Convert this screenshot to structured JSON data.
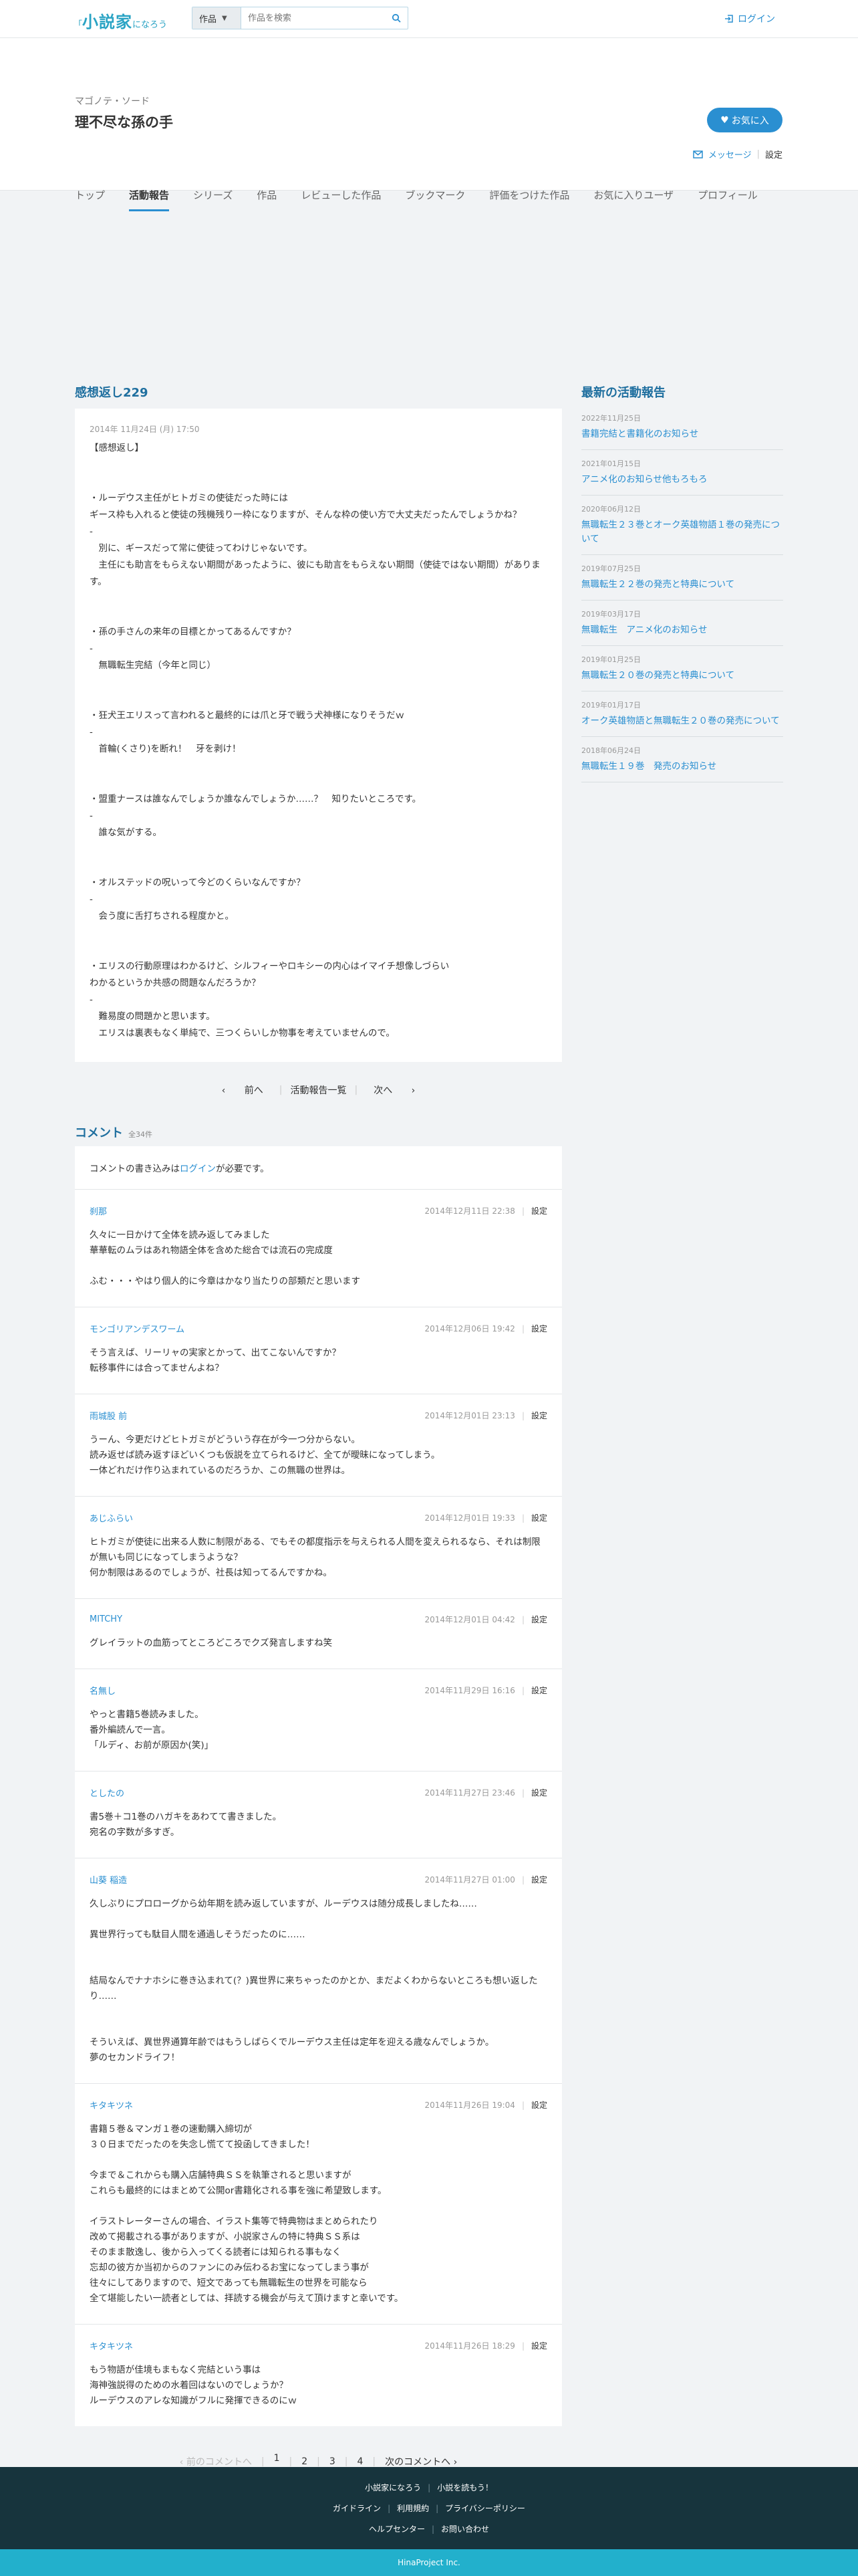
{
  "header": {
    "logo_small_left": "「",
    "logo_main": "小説家",
    "logo_small_right": "になろう",
    "search_select": "作品",
    "search_placeholder": "作品を検索",
    "login": "ログイン"
  },
  "user": {
    "sub": "マゴノテ・ソード",
    "name": "理不尽な孫の手",
    "favorite_button": "お気に入",
    "message": "メッセージ",
    "settings": "設定"
  },
  "tabs": [
    {
      "label": "トップ"
    },
    {
      "label": "活動報告"
    },
    {
      "label": "シリーズ"
    },
    {
      "label": "作品"
    },
    {
      "label": "レビューした作品"
    },
    {
      "label": "ブックマーク"
    },
    {
      "label": "評価をつけた作品"
    },
    {
      "label": "お気に入りユーザ"
    },
    {
      "label": "プロフィール"
    }
  ],
  "post": {
    "title": "感想返し229",
    "date": "2014年 11月24日 (月) 17:50",
    "body": "【感想返し】\n\n\n・ルーデウス主任がヒトガミの使徒だった時には\nギース枠も入れると使徒の残機残り一枠になりますが、そんな枠の使い方で大丈夫だったんでしょうかね？\n-\n　別に、ギースだって常に使徒ってわけじゃないです。\n　主任にも助言をもらえない期間があったように、彼にも助言をもらえない期間（使徒ではない期間）があります。\n\n\n・孫の手さんの来年の目標とかってあるんですか？\n-\n　無職転生完結（今年と同じ）\n\n\n・狂犬王エリスって言われると最終的には爪と牙で戦う犬神様になりそうだｗ\n-\n　首輪(くさり)を断れ！　牙を剥け！\n\n\n・盟重ナースは誰なんでしょうか誰なんでしょうか……？　知りたいところです。\n-\n　誰な気がする。\n\n\n・オルステッドの呪いって今どのくらいなんですか？\n-\n　会う度に舌打ちされる程度かと。\n\n\n・エリスの行動原理はわかるけど、シルフィーやロキシーの内心はイマイチ想像しづらい\nわかるというか共感の問題なんだろうか？\n-\n　難易度の問題かと思います。\n　エリスは裏表もなく単純で、三つくらいしか物事を考えていませんので。",
    "pager_prev": "前へ",
    "pager_list": "活動報告一覧",
    "pager_next": "次へ"
  },
  "comments": {
    "title": "コメント",
    "count": "全34件",
    "login_note_before": "コメントの書き込みは",
    "login_note_link": "ログイン",
    "login_note_after": "が必要です。",
    "settings": "設定",
    "items": [
      {
        "name": "刹那",
        "date": "2014年12月11日 22:38",
        "text": "久々に一日かけて全体を読み返してみました\n華華転のムラはあれ物語全体を含めた総合では流石の完成度\n\nふむ・・・やはり個人的に今章はかなり当たりの部類だと思います"
      },
      {
        "name": "モンゴリアンデスワーム",
        "date": "2014年12月06日 19:42",
        "text": "そう言えば、リーリャの実家とかって、出てこないんですか？\n転移事件には合ってませんよね？"
      },
      {
        "name": "雨城股 前",
        "date": "2014年12月01日 23:13",
        "text": "うーん、今更だけどヒトガミがどういう存在が今一つ分からない。\n読み返せば読み返すほどいくつも仮説を立てられるけど、全てが曖昧になってしまう。\n一体どれだけ作り込まれているのだろうか、この無職の世界は。"
      },
      {
        "name": "あじふらい",
        "date": "2014年12月01日 19:33",
        "text": "ヒトガミが使徒に出来る人数に制限がある、でもその都度指示を与えられる人間を変えられるなら、それは制限が無いも同じになってしまうような？\n何か制限はあるのでしょうが、社長は知ってるんですかね。"
      },
      {
        "name": "MITCHY",
        "date": "2014年12月01日 04:42",
        "text": "グレイラットの血筋ってところどころでクズ発言しますね笑"
      },
      {
        "name": "名無し",
        "date": "2014年11月29日 16:16",
        "text": "やっと書籍5巻読みました。\n番外編読んで一言。\n「ルディ、お前が原因か(笑)」"
      },
      {
        "name": "としたの",
        "date": "2014年11月27日 23:46",
        "text": "書5巻＋コ1巻のハガキをあわてて書きました。\n宛名の字数が多すぎ。"
      },
      {
        "name": "山葵 稲造",
        "date": "2014年11月27日 01:00",
        "text": "久しぶりにプロローグから幼年期を読み返していますが、ルーデウスは随分成長しましたね……\n\n異世界行っても駄目人間を通過しそうだったのに……\n\n\n結局なんでナナホシに巻き込まれて(？)異世界に来ちゃったのかとか、まだよくわからないところも想い返したり……\n\n\nそういえば、異世界通算年齢ではもうしばらくでルーデウス主任は定年を迎える歳なんでしょうか。\n夢のセカンドライフ！"
      },
      {
        "name": "キタキツネ",
        "date": "2014年11月26日 19:04",
        "text": "書籍５巻＆マンガ１巻の速動購入締切が\n３０日までだったのを失念し慌てて投函してきました！\n\n今まで＆これからも購入店舗特典ＳＳを執筆されると思いますが\nこれらも最終的にはまとめて公開or書籍化される事を強に希望致します。\n\nイラストレーターさんの場合、イラスト集等で特典物はまとめられたり\n改めて掲載される事がありますが、小説家さんの特に特典ＳＳ系は\nそのまま散逸し、後から入ってくる読者には知られる事もなく\n忘却の彼方か当初からのファンにのみ伝わるお宝になってしまう事が\n往々にしてありますので、短文であっても無職転生の世界を可能なら\n全て堪能したい一読者としては、拝読する機会が与えて頂けますと幸いです。"
      },
      {
        "name": "キタキツネ",
        "date": "2014年11月26日 18:29",
        "text": "もう物語が佳境もまもなく完結という事は\n海神強説得のための水着回はないのでしょうか？\nルーデウスのアレな知識がフルに発揮できるのにｗ"
      }
    ],
    "pager": {
      "prev": "前のコメントへ",
      "pages": [
        "1",
        "2",
        "3",
        "4"
      ],
      "next": "次のコメントへ"
    }
  },
  "news": {
    "title": "最新の活動報告",
    "items": [
      {
        "date": "2022年11月25日",
        "title": "書籍完結と書籍化のお知らせ"
      },
      {
        "date": "2021年01月15日",
        "title": "アニメ化のお知らせ他もろもろ"
      },
      {
        "date": "2020年06月12日",
        "title": "無職転生２３巻とオーク英雄物語１巻の発売について"
      },
      {
        "date": "2019年07月25日",
        "title": "無職転生２２巻の発売と特典について"
      },
      {
        "date": "2019年03月17日",
        "title": "無職転生　アニメ化のお知らせ"
      },
      {
        "date": "2019年01月25日",
        "title": "無職転生２０巻の発売と特典について"
      },
      {
        "date": "2019年01月17日",
        "title": "オーク英雄物語と無職転生２０巻の発売について"
      },
      {
        "date": "2018年06月24日",
        "title": "無職転生１９巻　発売のお知らせ"
      }
    ]
  },
  "footer": {
    "link1": "小説家になろう",
    "link2": "小説を読もう！",
    "link3": "ガイドライン",
    "link4": "利用規約",
    "link5": "プライバシーポリシー",
    "link6": "ヘルプセンター",
    "link7": "お問い合わせ",
    "copyright": "HinaProject Inc."
  },
  "colors": {
    "accent": "#2a8fd1",
    "footer_dark": "#17343d",
    "footer_bar": "#22b0cc"
  }
}
